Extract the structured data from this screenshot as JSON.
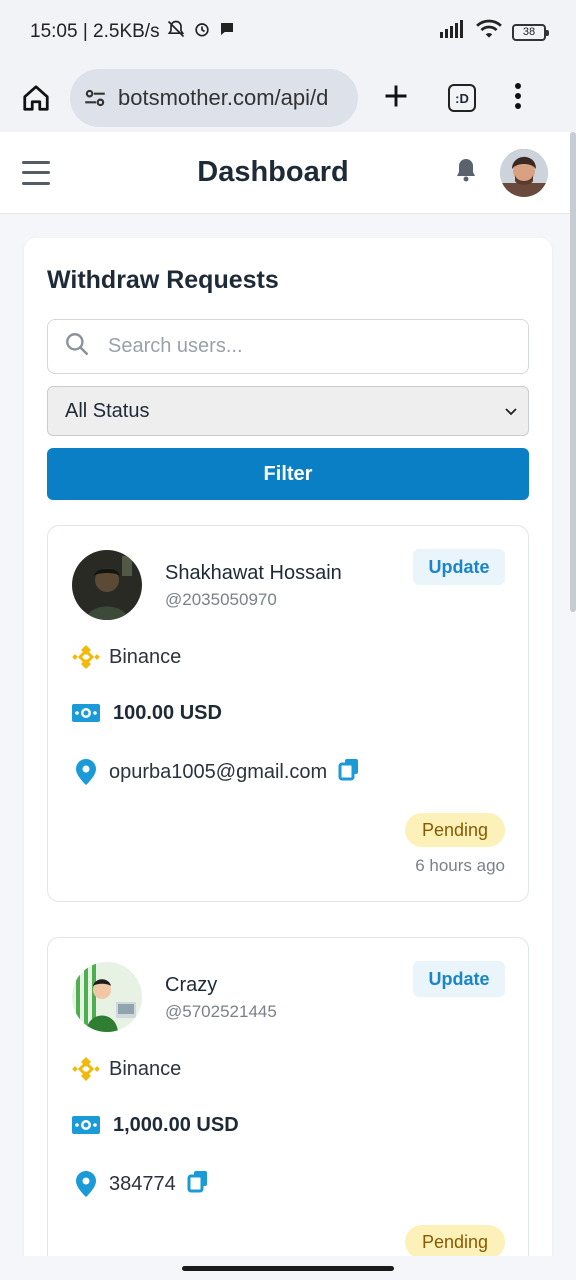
{
  "status_bar": {
    "time_speed": "15:05 | 2.5KB/s",
    "battery": "38"
  },
  "browser": {
    "url": "botsmother.com/api/d",
    "tabs_label": ":D"
  },
  "header": {
    "title": "Dashboard"
  },
  "main": {
    "section_title": "Withdraw Requests",
    "search_placeholder": "Search users...",
    "status_selected": "All Status",
    "filter_label": "Filter"
  },
  "requests": [
    {
      "name": "Shakhawat Hossain",
      "handle": "@2035050970",
      "update_label": "Update",
      "method": "Binance",
      "amount": "100.00 USD",
      "address": "opurba1005@gmail.com",
      "status": "Pending",
      "time": "6 hours ago"
    },
    {
      "name": "Crazy",
      "handle": "@5702521445",
      "update_label": "Update",
      "method": "Binance",
      "amount": "1,000.00 USD",
      "address": "384774",
      "status": "Pending"
    }
  ],
  "colors": {
    "primary": "#0a7fc6",
    "binance": "#f0b90b",
    "pending_bg": "#fcf1b8",
    "pending_text": "#8a5a00",
    "icon_blue": "#1a9ad6"
  }
}
